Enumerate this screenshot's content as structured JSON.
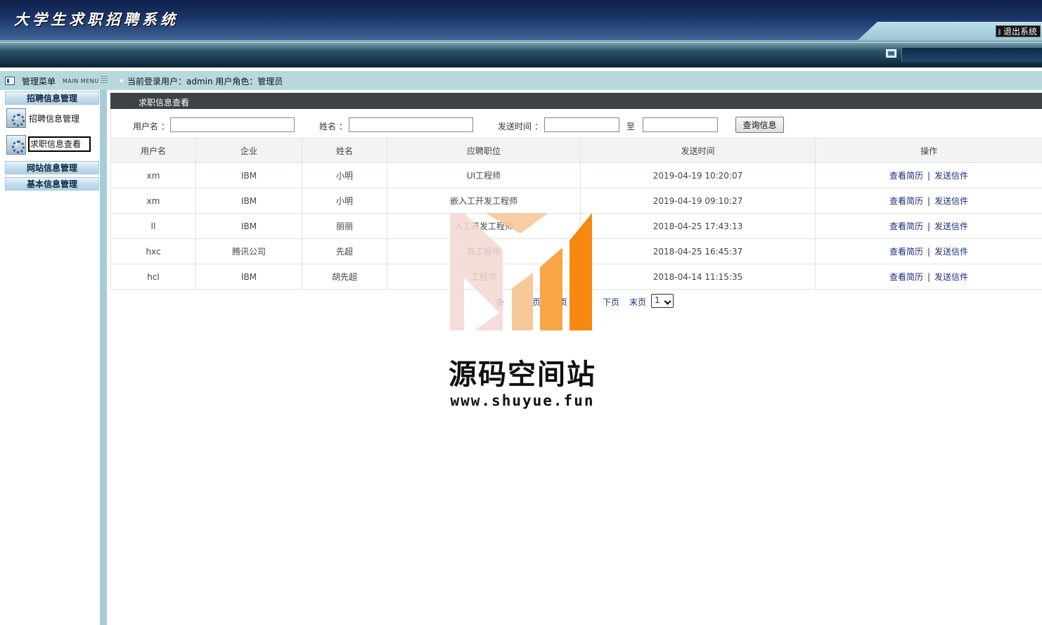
{
  "header": {
    "app_title": "大学生求职招聘系统",
    "logout_label": "退出系统"
  },
  "infobar": {
    "menu_title": "管理菜单",
    "menu_subtitle": "MAIN MENU",
    "user_info": "当前登录用户：admin  用户角色：管理员"
  },
  "sidebar": {
    "groups": [
      {
        "label": "招聘信息管理"
      },
      {
        "label": "网站信息管理"
      },
      {
        "label": "基本信息管理"
      }
    ],
    "items": [
      {
        "label": "招聘信息管理",
        "icon": "gear-icon"
      },
      {
        "label": "求职信息查看",
        "icon": "gear-icon",
        "active": true
      }
    ]
  },
  "main": {
    "panel_title": "求职信息查看",
    "search": {
      "username_label": "用户名 ：",
      "name_label": "姓名 ：",
      "time_label": "发送时间 ：",
      "to_label": "至",
      "button_label": "查询信息",
      "username_value": "",
      "name_value": "",
      "time_from_value": "",
      "time_to_value": ""
    },
    "table": {
      "columns": [
        "用户名",
        "企业",
        "姓名",
        "应聘职位",
        "发送时间",
        "操作"
      ],
      "rows": [
        {
          "username": "xm",
          "company": "IBM",
          "name": "小明",
          "position": "UI工程师",
          "time": "2019-04-19 10:20:07"
        },
        {
          "username": "xm",
          "company": "IBM",
          "name": "小明",
          "position": "嵌入工开发工程师",
          "time": "2019-04-19 09:10:27"
        },
        {
          "username": "ll",
          "company": "IBM",
          "name": "丽丽",
          "position": "入工开发工程师",
          "time": "2018-04-25 17:43:13"
        },
        {
          "username": "hxc",
          "company": "腾讯公司",
          "name": "先超",
          "position": "高工程师",
          "time": "2018-04-25 16:45:37"
        },
        {
          "username": "hcl",
          "company": "IBM",
          "name": "胡先超",
          "position": "工程师",
          "time": "2018-04-14 11:15:35"
        }
      ],
      "action_view": "查看简历",
      "action_sep": "|",
      "action_send": "发送信件"
    },
    "pager": {
      "total_text": "条",
      "page_text": "页",
      "prev_text": "页",
      "next_label": "下页",
      "last_label": "末页",
      "current_page": "1"
    }
  },
  "watermark": {
    "name": "源码空间站",
    "url": "www.shuyue.fun",
    "colors": {
      "light": "#f3d7d3",
      "mid": "#f6c89a",
      "orange": "#f7a545",
      "dark": "#f7880f"
    }
  }
}
